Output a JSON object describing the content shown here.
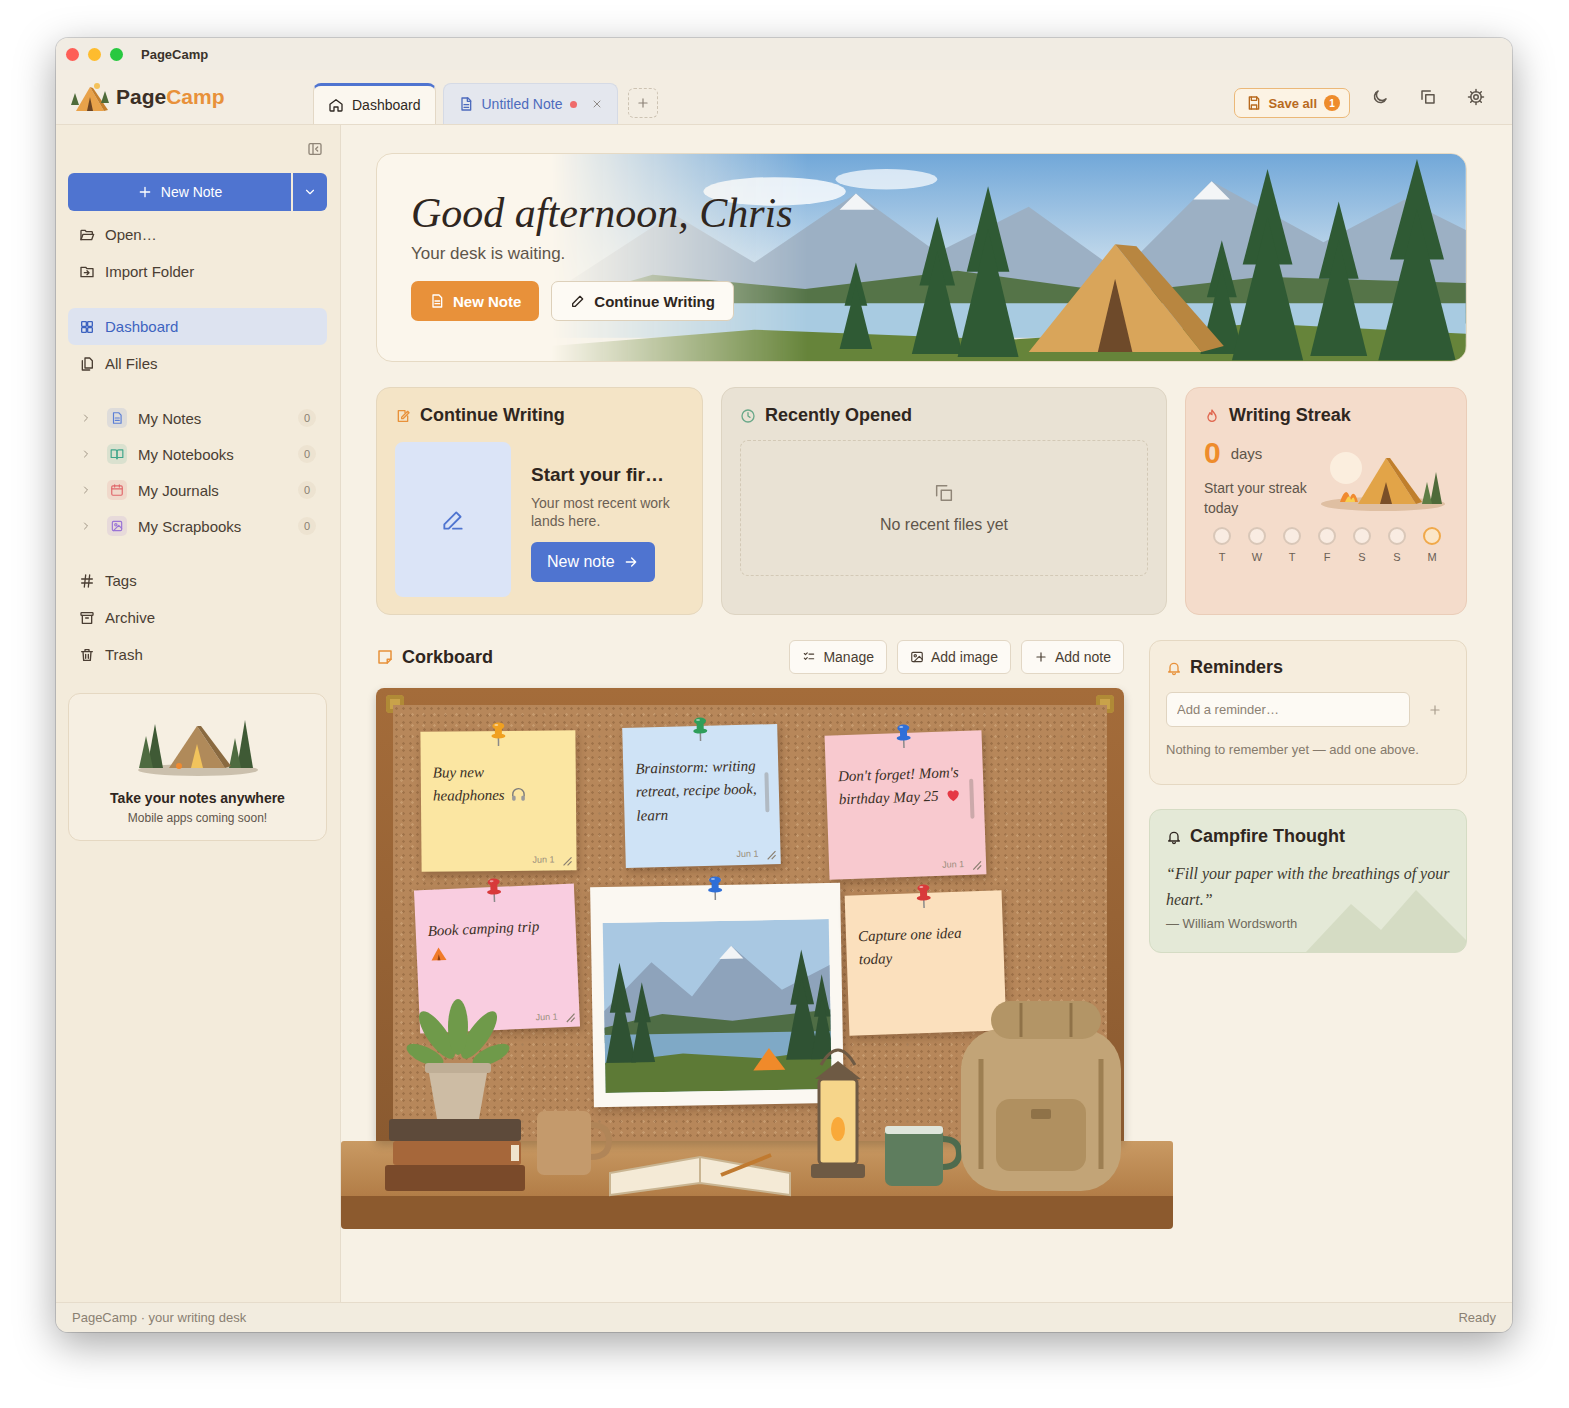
{
  "window": {
    "title": "PageCamp"
  },
  "header": {
    "logo": {
      "first": "Page",
      "second": "Camp"
    },
    "tabs": [
      {
        "label": "Dashboard",
        "selected": true,
        "unsaved": false,
        "closable": false,
        "kind": "home"
      },
      {
        "label": "Untitled Note",
        "selected": false,
        "unsaved": true,
        "closable": true,
        "kind": "note"
      }
    ],
    "save_all": {
      "label": "Save all",
      "badge": "1"
    }
  },
  "sidebar": {
    "new_note": "New Note",
    "actions": [
      {
        "label": "Open…",
        "kind": "open"
      },
      {
        "label": "Import Folder",
        "kind": "import"
      }
    ],
    "nav": [
      {
        "label": "Dashboard",
        "selected": true,
        "kind": "dashboard"
      },
      {
        "label": "All Files",
        "selected": false,
        "kind": "files"
      }
    ],
    "collections": [
      {
        "label": "My Notes",
        "count": "0",
        "expanded": false,
        "kind": "notes",
        "color": "#5b7fd6"
      },
      {
        "label": "My Notebooks",
        "count": "0",
        "expanded": false,
        "kind": "notebooks",
        "color": "#3fa58a"
      },
      {
        "label": "My Journals",
        "count": "0",
        "expanded": false,
        "kind": "journals",
        "color": "#e0676b"
      },
      {
        "label": "My Scrapbooks",
        "count": "0",
        "expanded": false,
        "kind": "scrapbooks",
        "color": "#9a74d6"
      }
    ],
    "library": [
      {
        "label": "Tags",
        "kind": "tags"
      },
      {
        "label": "Archive",
        "kind": "archive"
      },
      {
        "label": "Trash",
        "kind": "trash"
      }
    ],
    "promo": {
      "title": "Take your notes anywhere",
      "subtitle": "Mobile apps coming soon!"
    }
  },
  "hero": {
    "greeting": "Good afternoon, Chris",
    "subtitle": "Your desk is waiting.",
    "primary": "New Note",
    "secondary": "Continue Writing"
  },
  "continue_writing": {
    "title": "Continue Writing",
    "heading": "Start your fir…",
    "body": "Your most recent work lands here.",
    "button": "New note"
  },
  "recently_opened": {
    "title": "Recently Opened",
    "empty": "No recent files yet"
  },
  "writing_streak": {
    "title": "Writing Streak",
    "count": "0",
    "unit": "days",
    "prompt": "Start your streak today",
    "days": [
      {
        "label": "T",
        "today": false
      },
      {
        "label": "W",
        "today": false
      },
      {
        "label": "T",
        "today": false
      },
      {
        "label": "F",
        "today": false
      },
      {
        "label": "S",
        "today": false
      },
      {
        "label": "S",
        "today": false
      },
      {
        "label": "M",
        "today": true
      }
    ]
  },
  "corkboard": {
    "title": "Corkboard",
    "buttons": [
      {
        "label": "Manage",
        "kind": "manage"
      },
      {
        "label": "Add image",
        "kind": "image"
      },
      {
        "label": "Add note",
        "kind": "add"
      }
    ],
    "items": [
      {
        "kind": "note",
        "text": "Buy new headphones",
        "date": "Jun 1",
        "color": "#fbe6a2",
        "pin": "#f0a020",
        "scrollable": false
      },
      {
        "kind": "note",
        "text": "Brainstorm: writing retreat, recipe book, learn",
        "date": "Jun 1",
        "color": "#cfe3f6",
        "pin": "#2f9e5a",
        "scrollable": true
      },
      {
        "kind": "note",
        "text": "Don't forget! Mom's birthday May 25",
        "date": "Jun 1",
        "color": "#f8c9cf",
        "pin": "#2f6fd8",
        "scrollable": true
      },
      {
        "kind": "note",
        "text": "Book camping trip",
        "date": "Jun 1",
        "color": "#f9cde0",
        "pin": "#d83a3a",
        "scrollable": false
      },
      {
        "kind": "photo",
        "pin": "#2f6fd8"
      },
      {
        "kind": "note",
        "text": "Capture one idea today",
        "color": "#fbe0bd",
        "pin": "#d83a3a",
        "scrollable": false
      }
    ]
  },
  "reminders": {
    "title": "Reminders",
    "placeholder": "Add a reminder…",
    "empty": "Nothing to remember yet — add one above."
  },
  "campfire": {
    "title": "Campfire Thought",
    "quote": "“Fill your paper with the breathings of your heart.”",
    "author": "— William Wordsworth"
  },
  "status_bar": {
    "left": "PageCamp · your writing desk",
    "right": "Ready"
  }
}
